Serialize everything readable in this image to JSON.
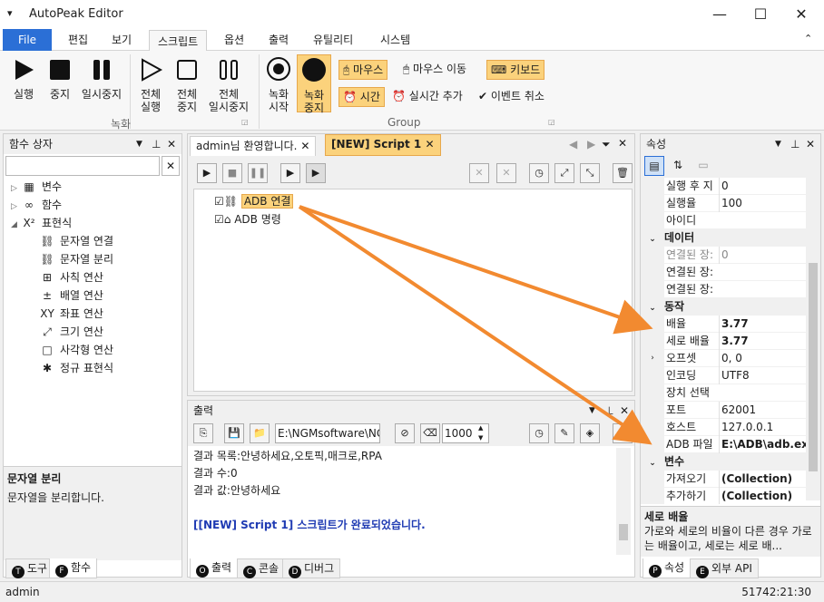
{
  "window": {
    "title": "AutoPeak Editor"
  },
  "menu": [
    "File",
    "편집",
    "보기",
    "스크립트",
    "옵션",
    "출력",
    "유틸리티",
    "시스템"
  ],
  "ribbon": {
    "rec_btns": [
      "실행",
      "중지",
      "일시중지"
    ],
    "all_btns": [
      "전체\n실행",
      "전체\n중지",
      "전체\n일시중지"
    ],
    "record_btns": [
      "녹화\n시작",
      "녹화\n중지"
    ],
    "small_btns": {
      "mouse": "마우스",
      "mouse_move": "마우스 이동",
      "keyboard": "키보드",
      "time": "시간",
      "realtime_add": "실시간 추가",
      "event_cancel": "이벤트 취소"
    },
    "group_rec": "녹화",
    "group_group": "Group"
  },
  "left_panel": {
    "title": "함수 상자",
    "tree": [
      {
        "label": "변수",
        "icon": "variable-icon",
        "glyph": "▦",
        "level": 0,
        "expander": "▷"
      },
      {
        "label": "함수",
        "icon": "function-icon",
        "glyph": "∞",
        "level": 0,
        "expander": "▷"
      },
      {
        "label": "표현식",
        "icon": "expression-icon",
        "glyph": "X²",
        "level": 0,
        "expander": "◢"
      },
      {
        "label": "문자열 연결",
        "icon": "link-icon",
        "glyph": "⛓",
        "level": 1
      },
      {
        "label": "문자열 분리",
        "icon": "unlink-icon",
        "glyph": "⛓",
        "level": 1
      },
      {
        "label": "사칙 연산",
        "icon": "calculator-icon",
        "glyph": "⊞",
        "level": 1
      },
      {
        "label": "배열 연산",
        "icon": "plus-minus-icon",
        "glyph": "±",
        "level": 1
      },
      {
        "label": "좌표 연산",
        "icon": "xy-icon",
        "glyph": "XY",
        "level": 1
      },
      {
        "label": "크기 연산",
        "icon": "resize-icon",
        "glyph": "⤢",
        "level": 1
      },
      {
        "label": "사각형 연산",
        "icon": "rectangle-icon",
        "glyph": "□",
        "level": 1
      },
      {
        "label": "정규 표현식",
        "icon": "asterisk-icon",
        "glyph": "✱",
        "level": 1
      }
    ],
    "desc_title": "문자열 분리",
    "desc_body": "문자열을 분리합니다.",
    "tabs": [
      {
        "letter": "T",
        "label": "도구"
      },
      {
        "letter": "F",
        "label": "함수"
      }
    ]
  },
  "editor": {
    "tabs": [
      "admin님 환영합니다.",
      "[NEW] Script 1"
    ],
    "nodes": [
      "ADB 연결",
      "ADB 명령"
    ]
  },
  "output": {
    "title": "출력",
    "path": "E:\\NGMsoftware\\NG",
    "count": "1000",
    "lines": [
      "결과 목록:안녕하세요,오토픽,매크로,RPA",
      "결과 수:0",
      "결과 값:안녕하세요",
      "",
      "[[NEW] Script 1] 스크립트가 완료되었습니다."
    ],
    "tabs": [
      {
        "letter": "O",
        "label": "출력"
      },
      {
        "letter": "C",
        "label": "콘솔"
      },
      {
        "letter": "D",
        "label": "디버그"
      }
    ]
  },
  "properties": {
    "title": "속성",
    "rows": [
      {
        "name": "실행 후 지",
        "value": "0"
      },
      {
        "name": "실행율",
        "value": "100"
      },
      {
        "name": "아이디",
        "value": ""
      },
      {
        "category": "데이터"
      },
      {
        "name": "연결된 장:",
        "value": "0",
        "muted": true
      },
      {
        "name": "연결된 장:",
        "value": ""
      },
      {
        "name": "연결된 장:",
        "value": ""
      },
      {
        "category": "동작"
      },
      {
        "name": "배율",
        "value": "3.77",
        "bold": true
      },
      {
        "name": "세로 배율",
        "value": "3.77",
        "bold": true
      },
      {
        "name": "오프셋",
        "value": "0, 0",
        "expander": true
      },
      {
        "name": "인코딩",
        "value": "UTF8"
      },
      {
        "name": "장치 선택",
        "value": ""
      },
      {
        "name": "포트",
        "value": "62001"
      },
      {
        "name": "호스트",
        "value": "127.0.0.1"
      },
      {
        "name": "ADB 파일",
        "value": "E:\\ADB\\adb.exe",
        "bold": true
      },
      {
        "category": "변수"
      },
      {
        "name": "가져오기",
        "value": "(Collection)",
        "bold": true
      },
      {
        "name": "추가하기",
        "value": "(Collection)",
        "bold": true
      }
    ],
    "desc_title": "세로 배율",
    "desc_body": "가로와 세로의 비율이 다른 경우 가로는 배율이고, 세로는 세로 배...",
    "tabs": [
      {
        "letter": "P",
        "label": "속성"
      },
      {
        "letter": "E",
        "label": "외부 API"
      }
    ]
  },
  "status": {
    "user": "admin",
    "time": "51742:21:30"
  },
  "colors": {
    "accent": "#2b6fd6",
    "arrow": "#f28a30",
    "highlight": "#fbd27c",
    "link_text": "#1f3bb3"
  }
}
